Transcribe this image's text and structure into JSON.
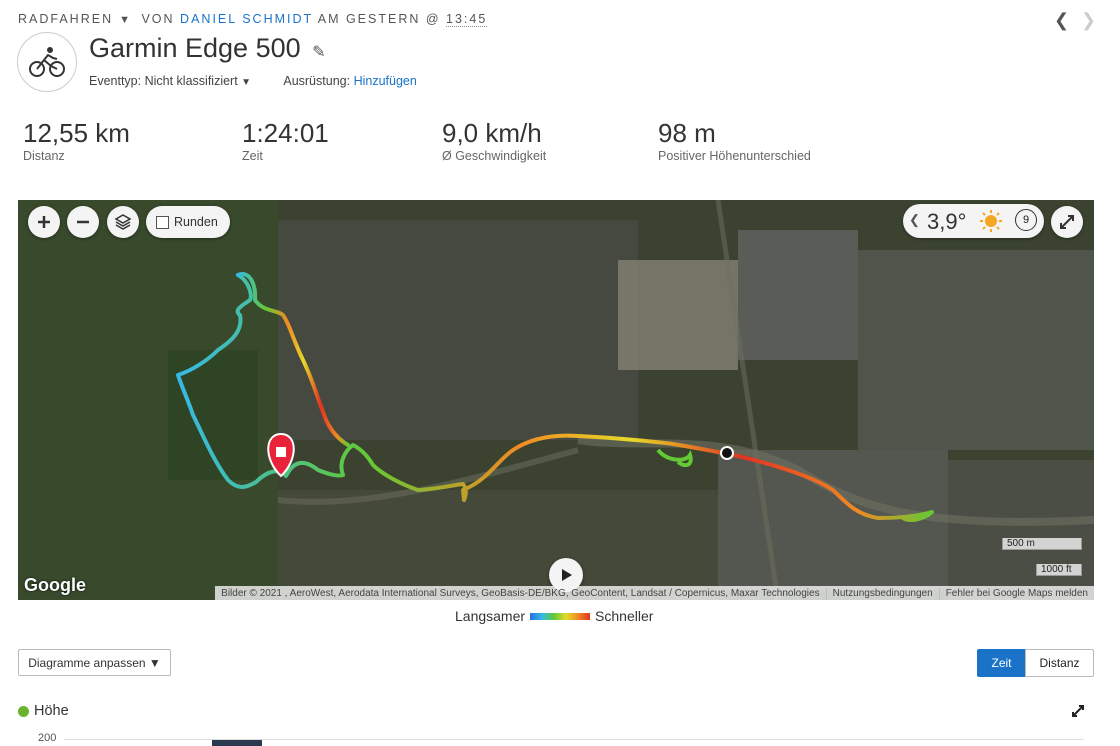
{
  "header": {
    "activity_type": "RADFAHREN",
    "by_word": "VON",
    "author": "DANIEL SCHMIDT",
    "when": "AM GESTERN @",
    "time": "13:45",
    "title": "Garmin Edge 500",
    "event_label": "Eventtyp:",
    "event_value": "Nicht klassifiziert",
    "gear_label": "Ausrüstung:",
    "gear_link": "Hinzufügen"
  },
  "stats": [
    {
      "value": "12,55 km",
      "label": "Distanz"
    },
    {
      "value": "1:24:01",
      "label": "Zeit"
    },
    {
      "value": "9,0 km/h",
      "label": "Ø Geschwindigkeit"
    },
    {
      "value": "98 m",
      "label": "Positiver Höhenunterschied"
    }
  ],
  "map": {
    "runden_label": "Runden",
    "temperature": "3,9°",
    "wind_value": "9",
    "scale_metric": "500 m",
    "scale_imperial": "1000 ft",
    "google_logo": "Google",
    "attribution": "Bilder © 2021 , AeroWest, Aerodata International Surveys, GeoBasis-DE/BKG, GeoContent, Landsat / Copernicus, Maxar Technologies",
    "terms": "Nutzungsbedingungen",
    "report": "Fehler bei Google Maps melden"
  },
  "legend": {
    "slow": "Langsamer",
    "fast": "Schneller"
  },
  "controls": {
    "customize_label": "Diagramme anpassen ▼",
    "toggle_time": "Zeit",
    "toggle_distance": "Distanz"
  },
  "chart": {
    "title": "Höhe",
    "ytick_first": "200"
  },
  "colors": {
    "accent": "#1a73c9",
    "elevation_dot": "#6ab32d",
    "marker": "#e8233a"
  }
}
